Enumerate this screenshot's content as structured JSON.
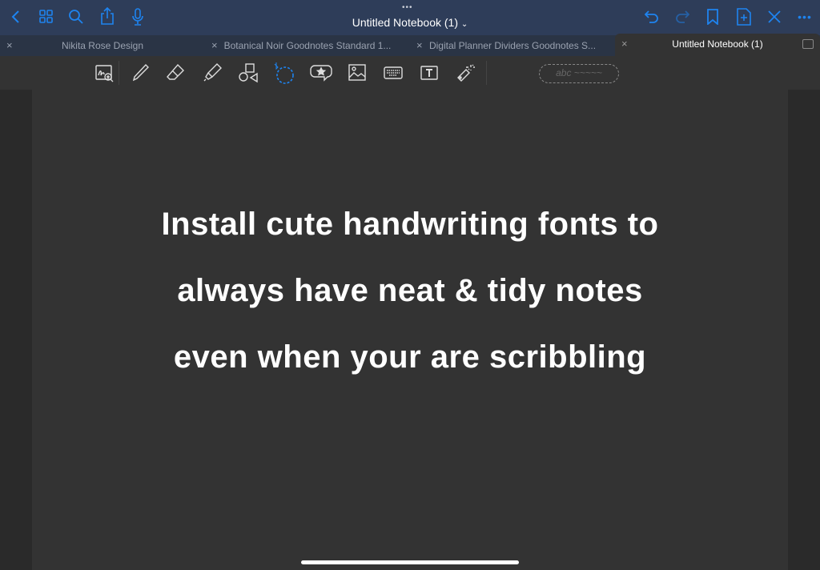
{
  "header": {
    "title": "Untitled Notebook (1)",
    "icons": [
      "back-icon",
      "grid-icon",
      "search-icon",
      "share-icon",
      "microphone-icon",
      "undo-icon",
      "redo-icon",
      "bookmark-icon",
      "add-page-icon",
      "close-icon",
      "more-icon"
    ]
  },
  "tabs": [
    {
      "label": "Nikita Rose Design",
      "active": false
    },
    {
      "label": "Botanical Noir Goodnotes Standard 1...",
      "active": false
    },
    {
      "label": "Digital Planner Dividers Goodnotes S...",
      "active": false
    },
    {
      "label": "Untitled Notebook (1)",
      "active": true
    }
  ],
  "toolbar": {
    "tools": [
      "zoom-window",
      "pen",
      "eraser",
      "highlighter",
      "shapes",
      "lasso",
      "elements",
      "image",
      "keyboard",
      "text",
      "laser-pointer"
    ],
    "active_tool": "lasso",
    "handwriting_placeholder": "abc ~~~~~"
  },
  "page": {
    "lines": [
      "Install cute handwriting fonts to",
      "always have neat & tidy notes",
      "even when your are scribbling"
    ]
  },
  "colors": {
    "accent": "#1e84f0",
    "header": "#2e3d59",
    "page": "#333333"
  }
}
